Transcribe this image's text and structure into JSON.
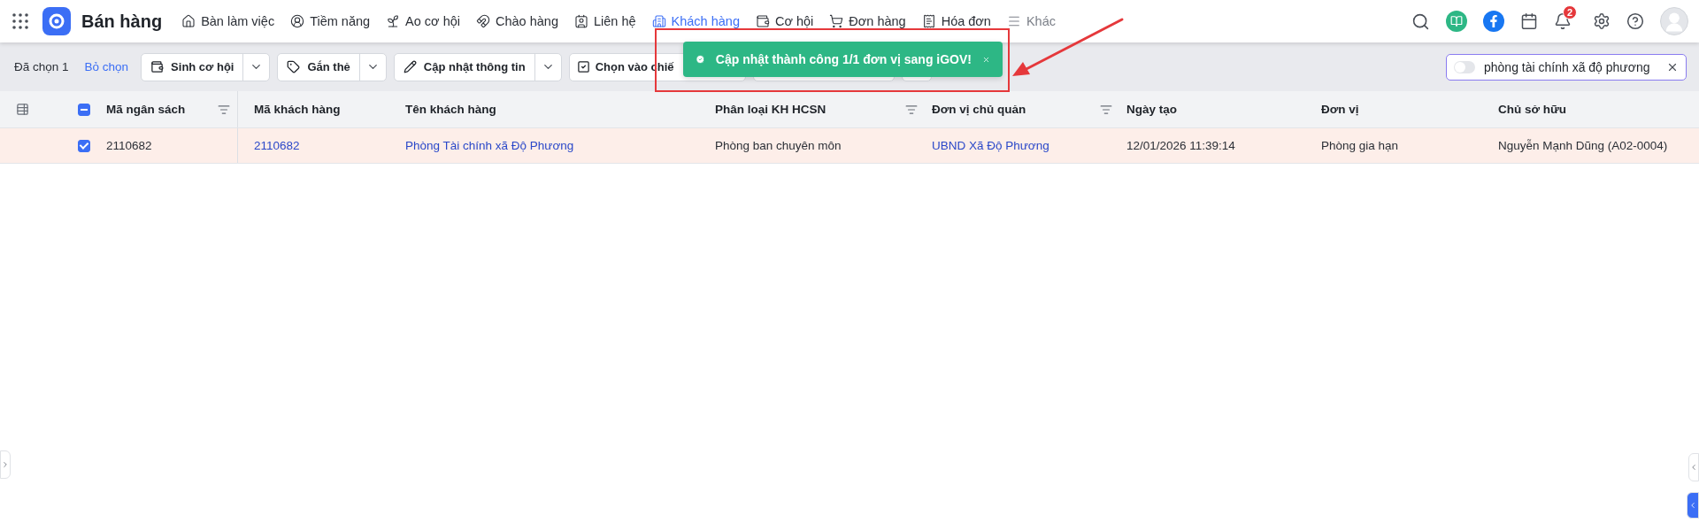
{
  "app": {
    "title": "Bán hàng",
    "notification_count": "2"
  },
  "nav": [
    {
      "label": "Bàn làm việc",
      "selected": false
    },
    {
      "label": "Tiềm năng",
      "selected": false
    },
    {
      "label": "Ao cơ hội",
      "selected": false
    },
    {
      "label": "Chào hàng",
      "selected": false
    },
    {
      "label": "Liên hệ",
      "selected": false
    },
    {
      "label": "Khách hàng",
      "selected": true
    },
    {
      "label": "Cơ hội",
      "selected": false
    },
    {
      "label": "Đơn hàng",
      "selected": false
    },
    {
      "label": "Hóa đơn",
      "selected": false
    },
    {
      "label": "Khác",
      "selected": false,
      "kind": "more"
    }
  ],
  "toolbar": {
    "selected_count": "Đã chọn 1",
    "deselect": "Bỏ chọn",
    "buttons": [
      {
        "label": "Sinh cơ hội"
      },
      {
        "label": "Gắn thẻ"
      },
      {
        "label": "Cập nhật thông tin"
      },
      {
        "label": "Chọn vào chiế",
        "kind": "cut"
      }
    ]
  },
  "search": {
    "value": "phòng tài chính xã độ phương",
    "on": false
  },
  "toast": {
    "message": "Cập nhật thành công 1/1 đơn vị sang iGOV!"
  },
  "table": {
    "select_all_partial": true,
    "columns": [
      {
        "label": "Mã ngân sách",
        "filter": true
      },
      {
        "label": "Mã khách hàng"
      },
      {
        "label": "Tên khách hàng"
      },
      {
        "label": "Phân loại KH HCSN",
        "filter": true
      },
      {
        "label": "Đơn vị chủ quản",
        "filter": true
      },
      {
        "label": "Ngày tạo"
      },
      {
        "label": "Đơn vị"
      },
      {
        "label": "Chủ sở hữu"
      }
    ],
    "rows": [
      {
        "checked": true,
        "cells": [
          {
            "text": "2110682",
            "kind": "text"
          },
          {
            "text": "2110682",
            "kind": "link"
          },
          {
            "text": "Phòng Tài chính xã Độ Phương",
            "kind": "link"
          },
          {
            "text": "Phòng ban chuyên môn",
            "kind": "text"
          },
          {
            "text": "UBND Xã Độ Phương",
            "kind": "link"
          },
          {
            "text": "12/01/2026 11:39:14",
            "kind": "text"
          },
          {
            "text": "Phòng gia hạn",
            "kind": "text"
          },
          {
            "text": "Nguyễn Mạnh Dũng (A02-0004)",
            "kind": "text"
          }
        ]
      }
    ]
  }
}
